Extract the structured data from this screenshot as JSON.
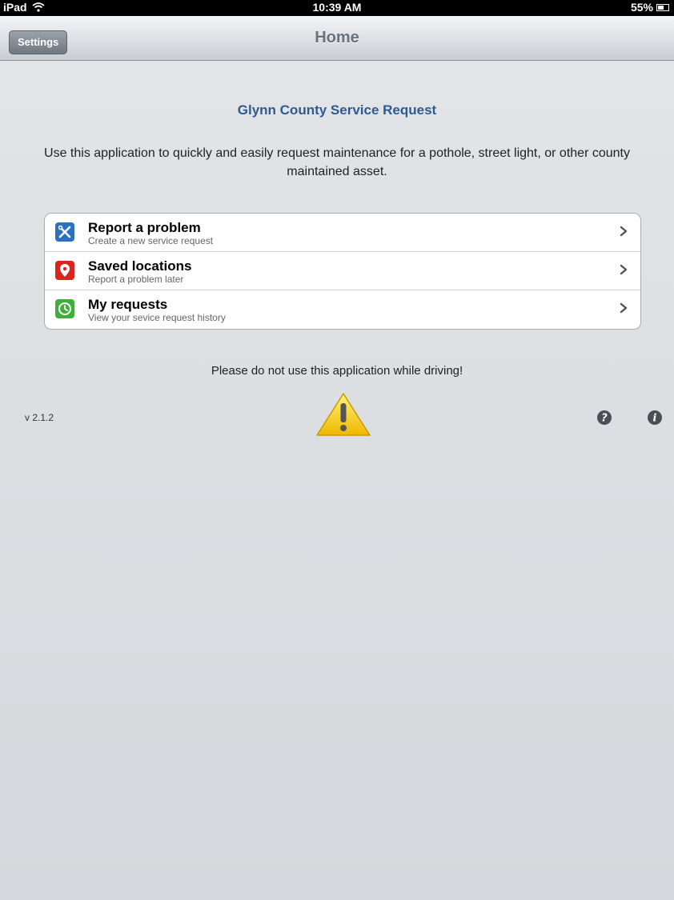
{
  "status_bar": {
    "device": "iPad",
    "time": "10:39 AM",
    "battery": "55%"
  },
  "nav": {
    "settings_label": "Settings",
    "title": "Home"
  },
  "main": {
    "app_title": "Glynn County Service Request",
    "intro": "Use this application to quickly and easily request maintenance for a pothole, street light, or other county maintained asset.",
    "menu": [
      {
        "label": "Report a problem",
        "subtitle": "Create a new service request",
        "icon": "tools-icon"
      },
      {
        "label": "Saved locations",
        "subtitle": "Report a problem later",
        "icon": "map-pin-icon"
      },
      {
        "label": "My requests",
        "subtitle": "View your sevice request history",
        "icon": "clock-icon"
      }
    ],
    "warning": "Please do not use this application while driving!"
  },
  "footer": {
    "version": "v 2.1.2"
  },
  "colors": {
    "title_blue": "#2e5b8f",
    "report_icon": "#2d6fc1",
    "saved_icon": "#d9261c",
    "requests_icon": "#3fae3a",
    "warning_yellow": "#f5c400"
  }
}
